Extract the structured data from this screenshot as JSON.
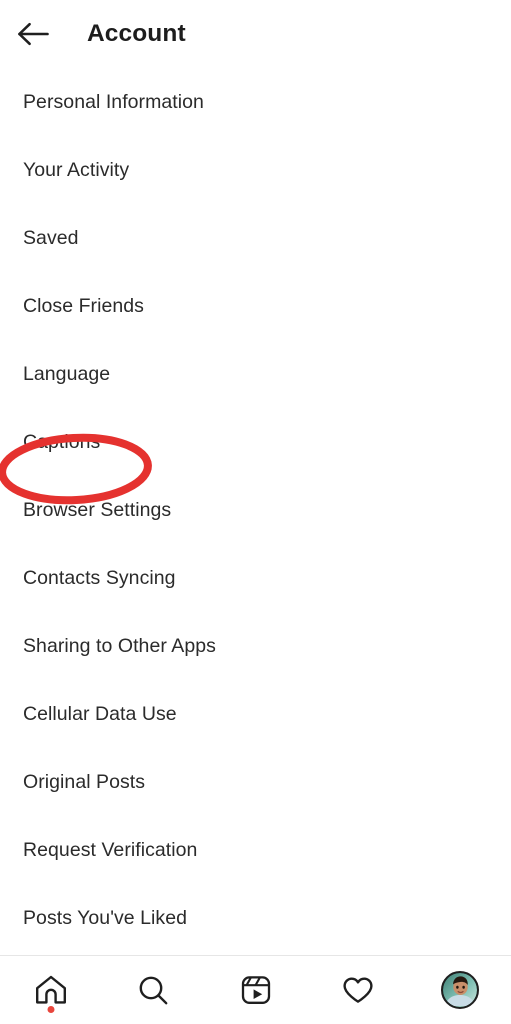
{
  "header": {
    "title": "Account",
    "back_icon": "arrow-left-icon"
  },
  "settings_list": {
    "items": [
      {
        "label": "Personal Information",
        "name": "personal-information"
      },
      {
        "label": "Your Activity",
        "name": "your-activity"
      },
      {
        "label": "Saved",
        "name": "saved"
      },
      {
        "label": "Close Friends",
        "name": "close-friends"
      },
      {
        "label": "Language",
        "name": "language"
      },
      {
        "label": "Captions",
        "name": "captions"
      },
      {
        "label": "Browser Settings",
        "name": "browser-settings"
      },
      {
        "label": "Contacts Syncing",
        "name": "contacts-syncing"
      },
      {
        "label": "Sharing to Other Apps",
        "name": "sharing-to-other-apps"
      },
      {
        "label": "Cellular Data Use",
        "name": "cellular-data-use"
      },
      {
        "label": "Original Posts",
        "name": "original-posts"
      },
      {
        "label": "Request Verification",
        "name": "request-verification"
      },
      {
        "label": "Posts You've Liked",
        "name": "posts-youve-liked"
      }
    ]
  },
  "annotation": {
    "type": "ellipse-highlight",
    "target_label": "Captions",
    "color": "#e5322f",
    "stroke_width": 8
  },
  "bottom_nav": {
    "items": [
      {
        "name": "home",
        "icon": "home-icon",
        "badge": true
      },
      {
        "name": "search",
        "icon": "search-icon",
        "badge": false
      },
      {
        "name": "reels",
        "icon": "reels-icon",
        "badge": false
      },
      {
        "name": "activity",
        "icon": "heart-icon",
        "badge": false
      },
      {
        "name": "profile",
        "icon": "avatar-icon",
        "badge": false
      }
    ],
    "badge_color": "#e8453c"
  },
  "colors": {
    "text_primary": "#2b2b2b",
    "title": "#1d1d1d",
    "background": "#ffffff",
    "divider": "#e6e6e6",
    "annotation_red": "#e5322f"
  }
}
